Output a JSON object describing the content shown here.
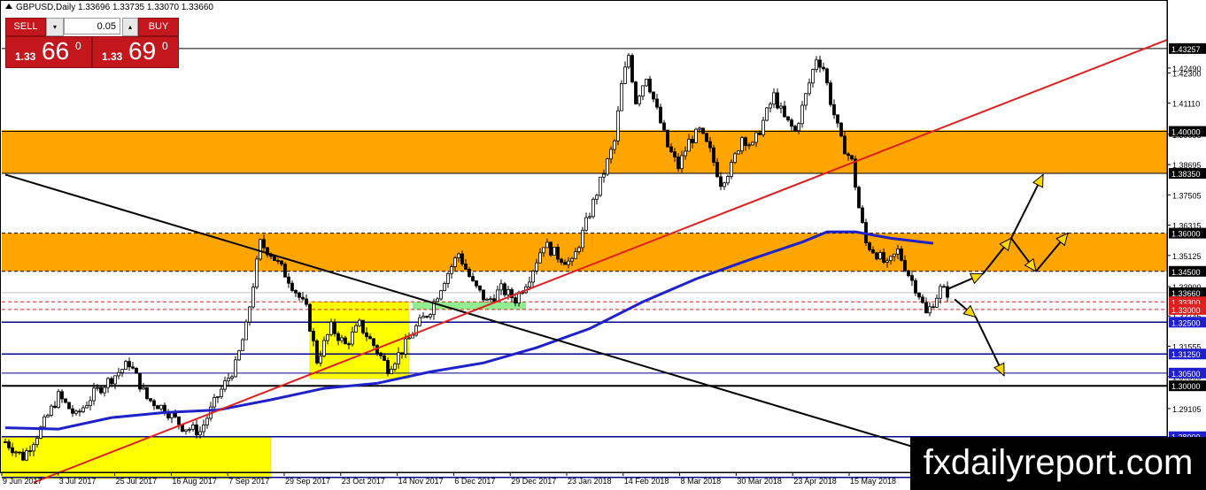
{
  "symbol_title": "GBPUSD,Daily  1.33696 1.33735 1.33070 1.33660",
  "trade_panel": {
    "sell_label": "SELL",
    "buy_label": "BUY",
    "volume": "0.05",
    "dropdown_glyph": "▾",
    "up_glyph": "▴",
    "sell_prefix": "1.33",
    "sell_big": "66",
    "sell_sup": "0",
    "buy_prefix": "1.33",
    "buy_big": "69",
    "buy_sup": "0"
  },
  "watermark": "fxdailyreport.com",
  "colors": {
    "zone_orange": "#FFA500",
    "zone_yellow": "#FFFF00",
    "zone_green": "#90EE90",
    "ma_blue": "#1E22C8",
    "trend_red": "#E02020",
    "trend_black": "#000000",
    "level_blue": "#00008B",
    "arrow_yellow": "#FFD700",
    "label_red": "#E02020",
    "label_blue": "#1F1FD0"
  },
  "chart_data": {
    "type": "candlestick",
    "symbol": "GBPUSD",
    "timeframe": "Daily",
    "ohlc_last": {
      "open": 1.33696,
      "high": 1.33735,
      "low": 1.3307,
      "close": 1.3366
    },
    "ylim": [
      1.266,
      1.444
    ],
    "x_ticks": [
      "9 Jun 2017",
      "3 Jul 2017",
      "25 Jul 2017",
      "16 Aug 2017",
      "7 Sep 2017",
      "29 Sep 2017",
      "23 Oct 2017",
      "14 Nov 2017",
      "6 Dec 2017",
      "29 Dec 2017",
      "23 Jan 2018",
      "14 Feb 2018",
      "8 Mar 2018",
      "30 Mar 2018",
      "23 Apr 2018",
      "15 May 2018"
    ],
    "y_axis_ticks": [
      "1.42490",
      "1.42300",
      "1.41110",
      "1.39885",
      "1.38695",
      "1.37505",
      "1.36315",
      "1.35125",
      "1.33900",
      "1.32745",
      "1.31555",
      "1.30365",
      "1.29105",
      "1.27935",
      "1.26745"
    ],
    "price_labels": [
      {
        "text": "1.43257",
        "value": 1.43257,
        "style": "black"
      },
      {
        "text": "1.40000",
        "value": 1.4,
        "style": "black"
      },
      {
        "text": "1.38350",
        "value": 1.3835,
        "style": "black"
      },
      {
        "text": "1.36000",
        "value": 1.36,
        "style": "black"
      },
      {
        "text": "1.34500",
        "value": 1.345,
        "style": "black"
      },
      {
        "text": "1.33660",
        "value": 1.3366,
        "style": "black"
      },
      {
        "text": "1.33300",
        "value": 1.333,
        "style": "red"
      },
      {
        "text": "1.33000",
        "value": 1.33,
        "style": "red"
      },
      {
        "text": "1.32500",
        "value": 1.325,
        "style": "blue"
      },
      {
        "text": "1.31250",
        "value": 1.3125,
        "style": "blue"
      },
      {
        "text": "1.30500",
        "value": 1.305,
        "style": "blue"
      },
      {
        "text": "1.30000",
        "value": 1.3,
        "style": "black"
      },
      {
        "text": "1.28000",
        "value": 1.28,
        "style": "blue"
      }
    ],
    "horizontal_levels": [
      {
        "value": 1.43257,
        "color": "#000000",
        "width": 1,
        "dash": false
      },
      {
        "value": 1.4,
        "color": "#000000",
        "width": 1,
        "dash": false
      },
      {
        "value": 1.3835,
        "color": "#000000",
        "width": 1,
        "dash": false
      },
      {
        "value": 1.36,
        "color": "#000000",
        "width": 1,
        "dash": true
      },
      {
        "value": 1.345,
        "color": "#000000",
        "width": 1,
        "dash": true
      },
      {
        "value": 1.3366,
        "color": "#C0C0C0",
        "width": 1,
        "dash": false
      },
      {
        "value": 1.333,
        "color": "#E02020",
        "width": 1,
        "dash": true
      },
      {
        "value": 1.33,
        "color": "#E02020",
        "width": 1,
        "dash": true
      },
      {
        "value": 1.325,
        "color": "#00008B",
        "width": 1.5,
        "dash": false
      },
      {
        "value": 1.3125,
        "color": "#00008B",
        "width": 1.5,
        "dash": false
      },
      {
        "value": 1.305,
        "color": "#00008B",
        "width": 1,
        "dash": false
      },
      {
        "value": 1.3,
        "color": "#000000",
        "width": 2,
        "dash": false
      },
      {
        "value": 1.28,
        "color": "#00008B",
        "width": 1.5,
        "dash": false
      },
      {
        "value": 1.264,
        "color": "#00008B",
        "width": 1.5,
        "dash": false
      }
    ],
    "zones": [
      {
        "kind": "orange",
        "bar_from": 0,
        "bar_to": 330,
        "y_top": 1.4005,
        "y_bottom": 1.3835
      },
      {
        "kind": "orange",
        "bar_from": 0,
        "bar_to": 330,
        "y_top": 1.36,
        "y_bottom": 1.345
      },
      {
        "kind": "yellow",
        "bar_from": 0,
        "bar_to": 75,
        "y_top": 1.28,
        "y_bottom": 1.2635
      },
      {
        "kind": "yellow",
        "bar_from": 87,
        "bar_to": 114,
        "y_top": 1.333,
        "y_bottom": 1.3028
      },
      {
        "kind": "green",
        "bar_from": 116,
        "bar_to": 147,
        "y_top": 1.333,
        "y_bottom": 1.33
      }
    ],
    "trendlines": [
      {
        "name": "black-downtrend",
        "color": "#000000",
        "points": [
          [
            0,
            1.383
          ],
          [
            266,
            1.272
          ]
        ]
      },
      {
        "name": "red-uptrend",
        "color": "#E02020",
        "points": [
          [
            8,
            1.262
          ],
          [
            330,
            1.436
          ]
        ]
      }
    ],
    "moving_average": {
      "color": "#1E22C8",
      "points": [
        [
          0,
          1.2835
        ],
        [
          15,
          1.283
        ],
        [
          30,
          1.2875
        ],
        [
          45,
          1.2895
        ],
        [
          60,
          1.2905
        ],
        [
          75,
          1.2945
        ],
        [
          90,
          1.299
        ],
        [
          105,
          1.301
        ],
        [
          120,
          1.3055
        ],
        [
          135,
          1.309
        ],
        [
          150,
          1.315
        ],
        [
          165,
          1.3225
        ],
        [
          180,
          1.333
        ],
        [
          195,
          1.342
        ],
        [
          210,
          1.3495
        ],
        [
          225,
          1.3565
        ],
        [
          232,
          1.3605
        ],
        [
          240,
          1.3605
        ],
        [
          250,
          1.358
        ],
        [
          262,
          1.356
        ]
      ]
    },
    "forecast_arrows": [
      {
        "from": [
          266,
          1.338
        ],
        "to": [
          276,
          1.344
        ]
      },
      {
        "from": [
          276,
          1.344
        ],
        "to": [
          284,
          1.358
        ]
      },
      {
        "from": [
          284,
          1.358
        ],
        "to": [
          293,
          1.383
        ]
      },
      {
        "from": [
          284,
          1.358
        ],
        "to": [
          291,
          1.345
        ]
      },
      {
        "from": [
          291,
          1.345
        ],
        "to": [
          300,
          1.36
        ]
      },
      {
        "from": [
          268,
          1.334
        ],
        "to": [
          274,
          1.327
        ]
      },
      {
        "from": [
          274,
          1.327
        ],
        "to": [
          282,
          1.304
        ]
      }
    ],
    "candles_anchors": [
      [
        0,
        1.278
      ],
      [
        5,
        1.272
      ],
      [
        10,
        1.283
      ],
      [
        15,
        1.296
      ],
      [
        20,
        1.288
      ],
      [
        25,
        1.297
      ],
      [
        30,
        1.303
      ],
      [
        35,
        1.309
      ],
      [
        40,
        1.295
      ],
      [
        45,
        1.291
      ],
      [
        50,
        1.284
      ],
      [
        55,
        1.282
      ],
      [
        60,
        1.296
      ],
      [
        65,
        1.308
      ],
      [
        68,
        1.323
      ],
      [
        70,
        1.34
      ],
      [
        72,
        1.356
      ],
      [
        75,
        1.352
      ],
      [
        80,
        1.342
      ],
      [
        85,
        1.33
      ],
      [
        88,
        1.31
      ],
      [
        92,
        1.323
      ],
      [
        96,
        1.316
      ],
      [
        100,
        1.324
      ],
      [
        104,
        1.316
      ],
      [
        108,
        1.307
      ],
      [
        112,
        1.314
      ],
      [
        116,
        1.323
      ],
      [
        120,
        1.33
      ],
      [
        124,
        1.342
      ],
      [
        128,
        1.352
      ],
      [
        132,
        1.34
      ],
      [
        136,
        1.333
      ],
      [
        140,
        1.338
      ],
      [
        144,
        1.334
      ],
      [
        148,
        1.343
      ],
      [
        152,
        1.356
      ],
      [
        156,
        1.351
      ],
      [
        160,
        1.348
      ],
      [
        163,
        1.36
      ],
      [
        166,
        1.372
      ],
      [
        169,
        1.384
      ],
      [
        172,
        1.396
      ],
      [
        174,
        1.418
      ],
      [
        176,
        1.43
      ],
      [
        178,
        1.412
      ],
      [
        181,
        1.422
      ],
      [
        184,
        1.408
      ],
      [
        187,
        1.394
      ],
      [
        190,
        1.386
      ],
      [
        193,
        1.396
      ],
      [
        196,
        1.4
      ],
      [
        199,
        1.392
      ],
      [
        202,
        1.38
      ],
      [
        205,
        1.386
      ],
      [
        208,
        1.398
      ],
      [
        211,
        1.394
      ],
      [
        214,
        1.404
      ],
      [
        217,
        1.414
      ],
      [
        220,
        1.405
      ],
      [
        223,
        1.4
      ],
      [
        226,
        1.414
      ],
      [
        229,
        1.429
      ],
      [
        231,
        1.425
      ],
      [
        233,
        1.412
      ],
      [
        236,
        1.396
      ],
      [
        239,
        1.388
      ],
      [
        241,
        1.37
      ],
      [
        243,
        1.356
      ],
      [
        246,
        1.352
      ],
      [
        249,
        1.347
      ],
      [
        252,
        1.353
      ],
      [
        255,
        1.344
      ],
      [
        258,
        1.336
      ],
      [
        260,
        1.328
      ],
      [
        262,
        1.333
      ],
      [
        264,
        1.338
      ],
      [
        266,
        1.3366
      ]
    ]
  }
}
